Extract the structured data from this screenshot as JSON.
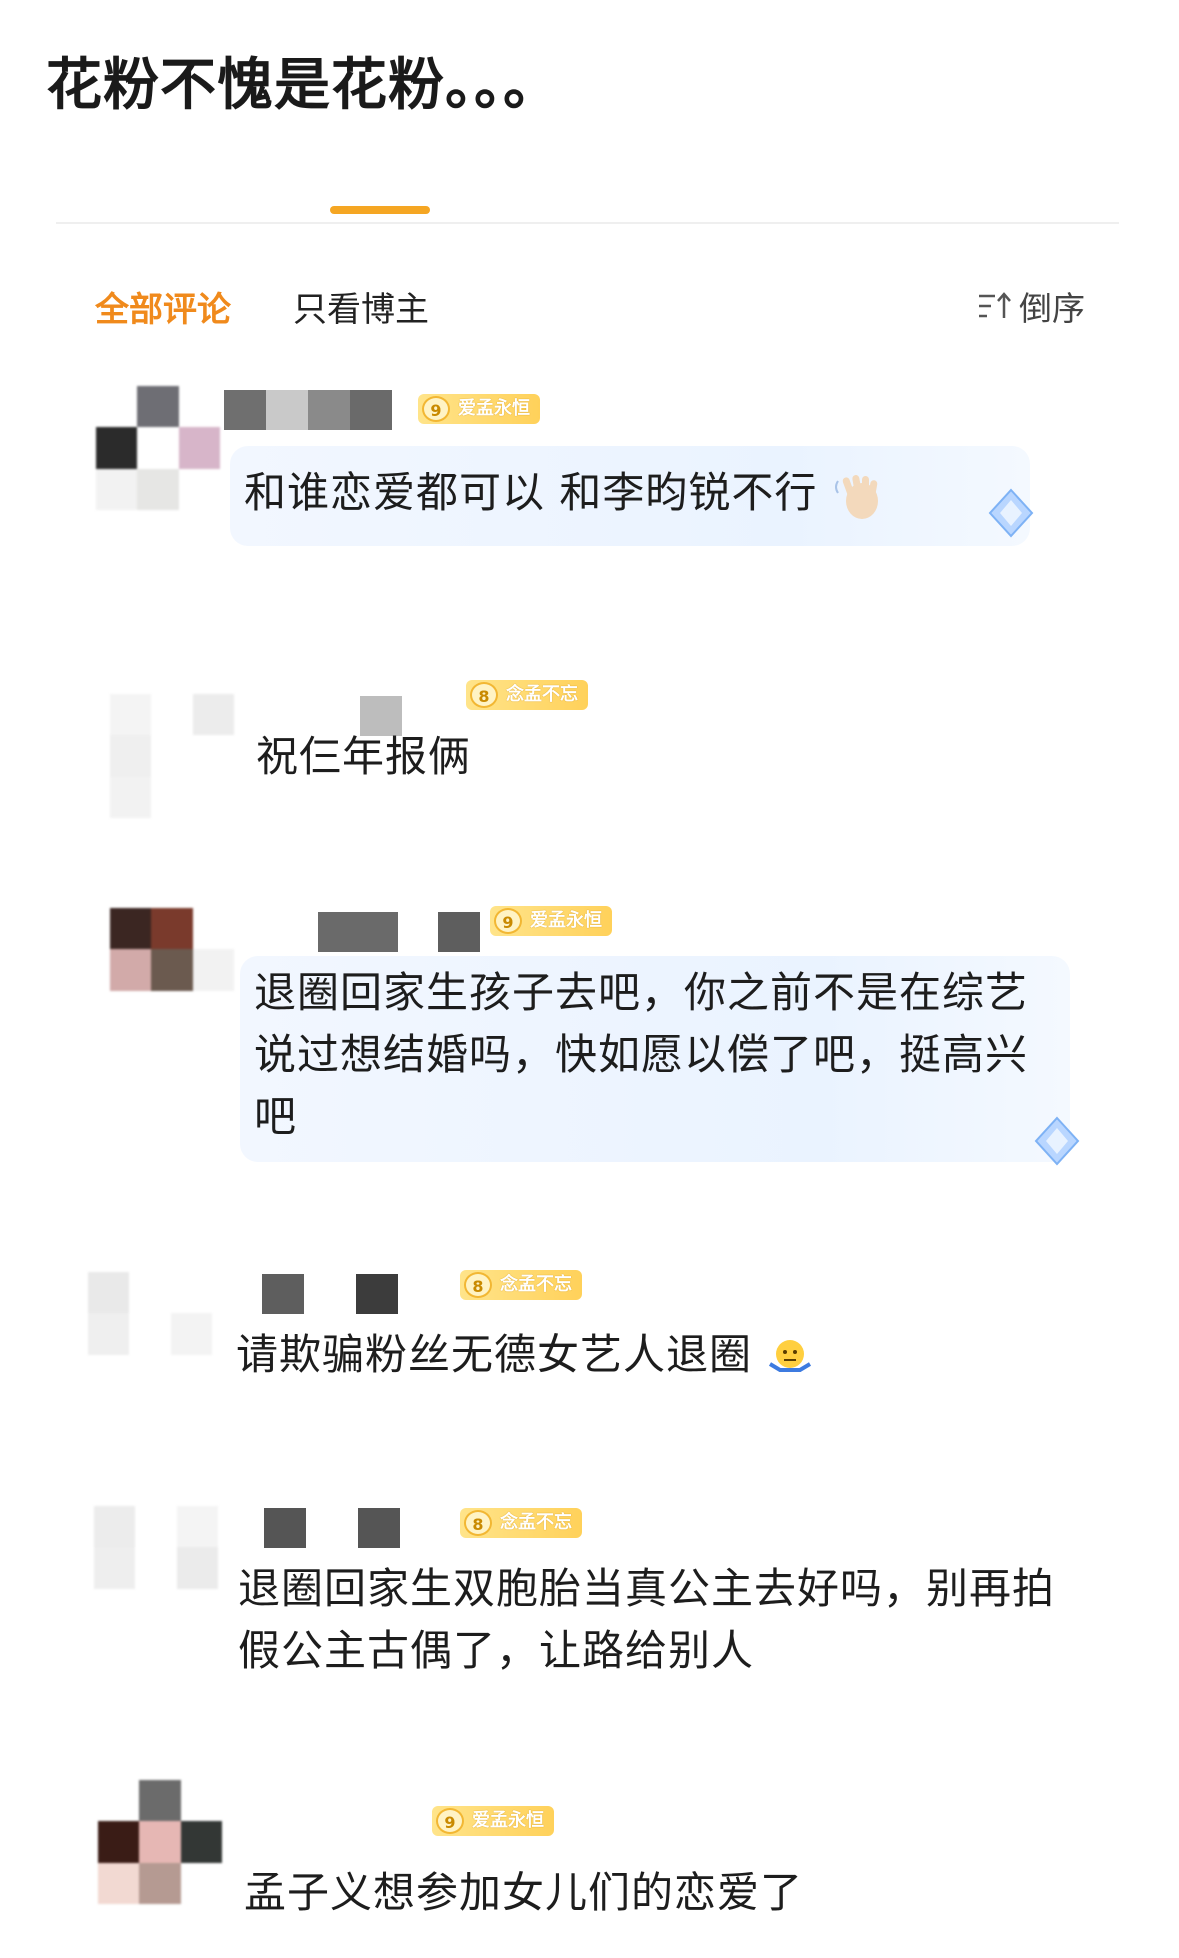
{
  "post": {
    "title": "花粉不愧是花粉。。。"
  },
  "filters": {
    "all_comments": "全部评论",
    "blogger_only": "只看博主",
    "sort_label": "倒序"
  },
  "comments": [
    {
      "badge_level": "9",
      "badge_text": "爱孟永恒",
      "text": "和谁恋爱都可以 和李昀锐不行",
      "emoji": "waving-hand-icon"
    },
    {
      "badge_level": "8",
      "badge_text": "念孟不忘",
      "text": "祝仨年报俩"
    },
    {
      "badge_level": "9",
      "badge_text": "爱孟永恒",
      "text": "退圈回家生孩子去吧，你之前不是在综艺说过想结婚吗，快如愿以偿了吧，挺高兴吧"
    },
    {
      "badge_level": "8",
      "badge_text": "念孟不忘",
      "text": "请欺骗粉丝无德女艺人退圈",
      "emoji": "shrug-icon"
    },
    {
      "badge_level": "8",
      "badge_text": "念孟不忘",
      "text": "退圈回家生双胞胎当真公主去好吗，别再拍假公主古偶了，让路给别人"
    },
    {
      "badge_level": "9",
      "badge_text": "爱孟永恒",
      "text": "孟子义想参加女儿们的恋爱了"
    }
  ],
  "colors": {
    "accent": "#f08a1c",
    "badge": "#ffd15a",
    "bubble": "#eaf3ff"
  }
}
